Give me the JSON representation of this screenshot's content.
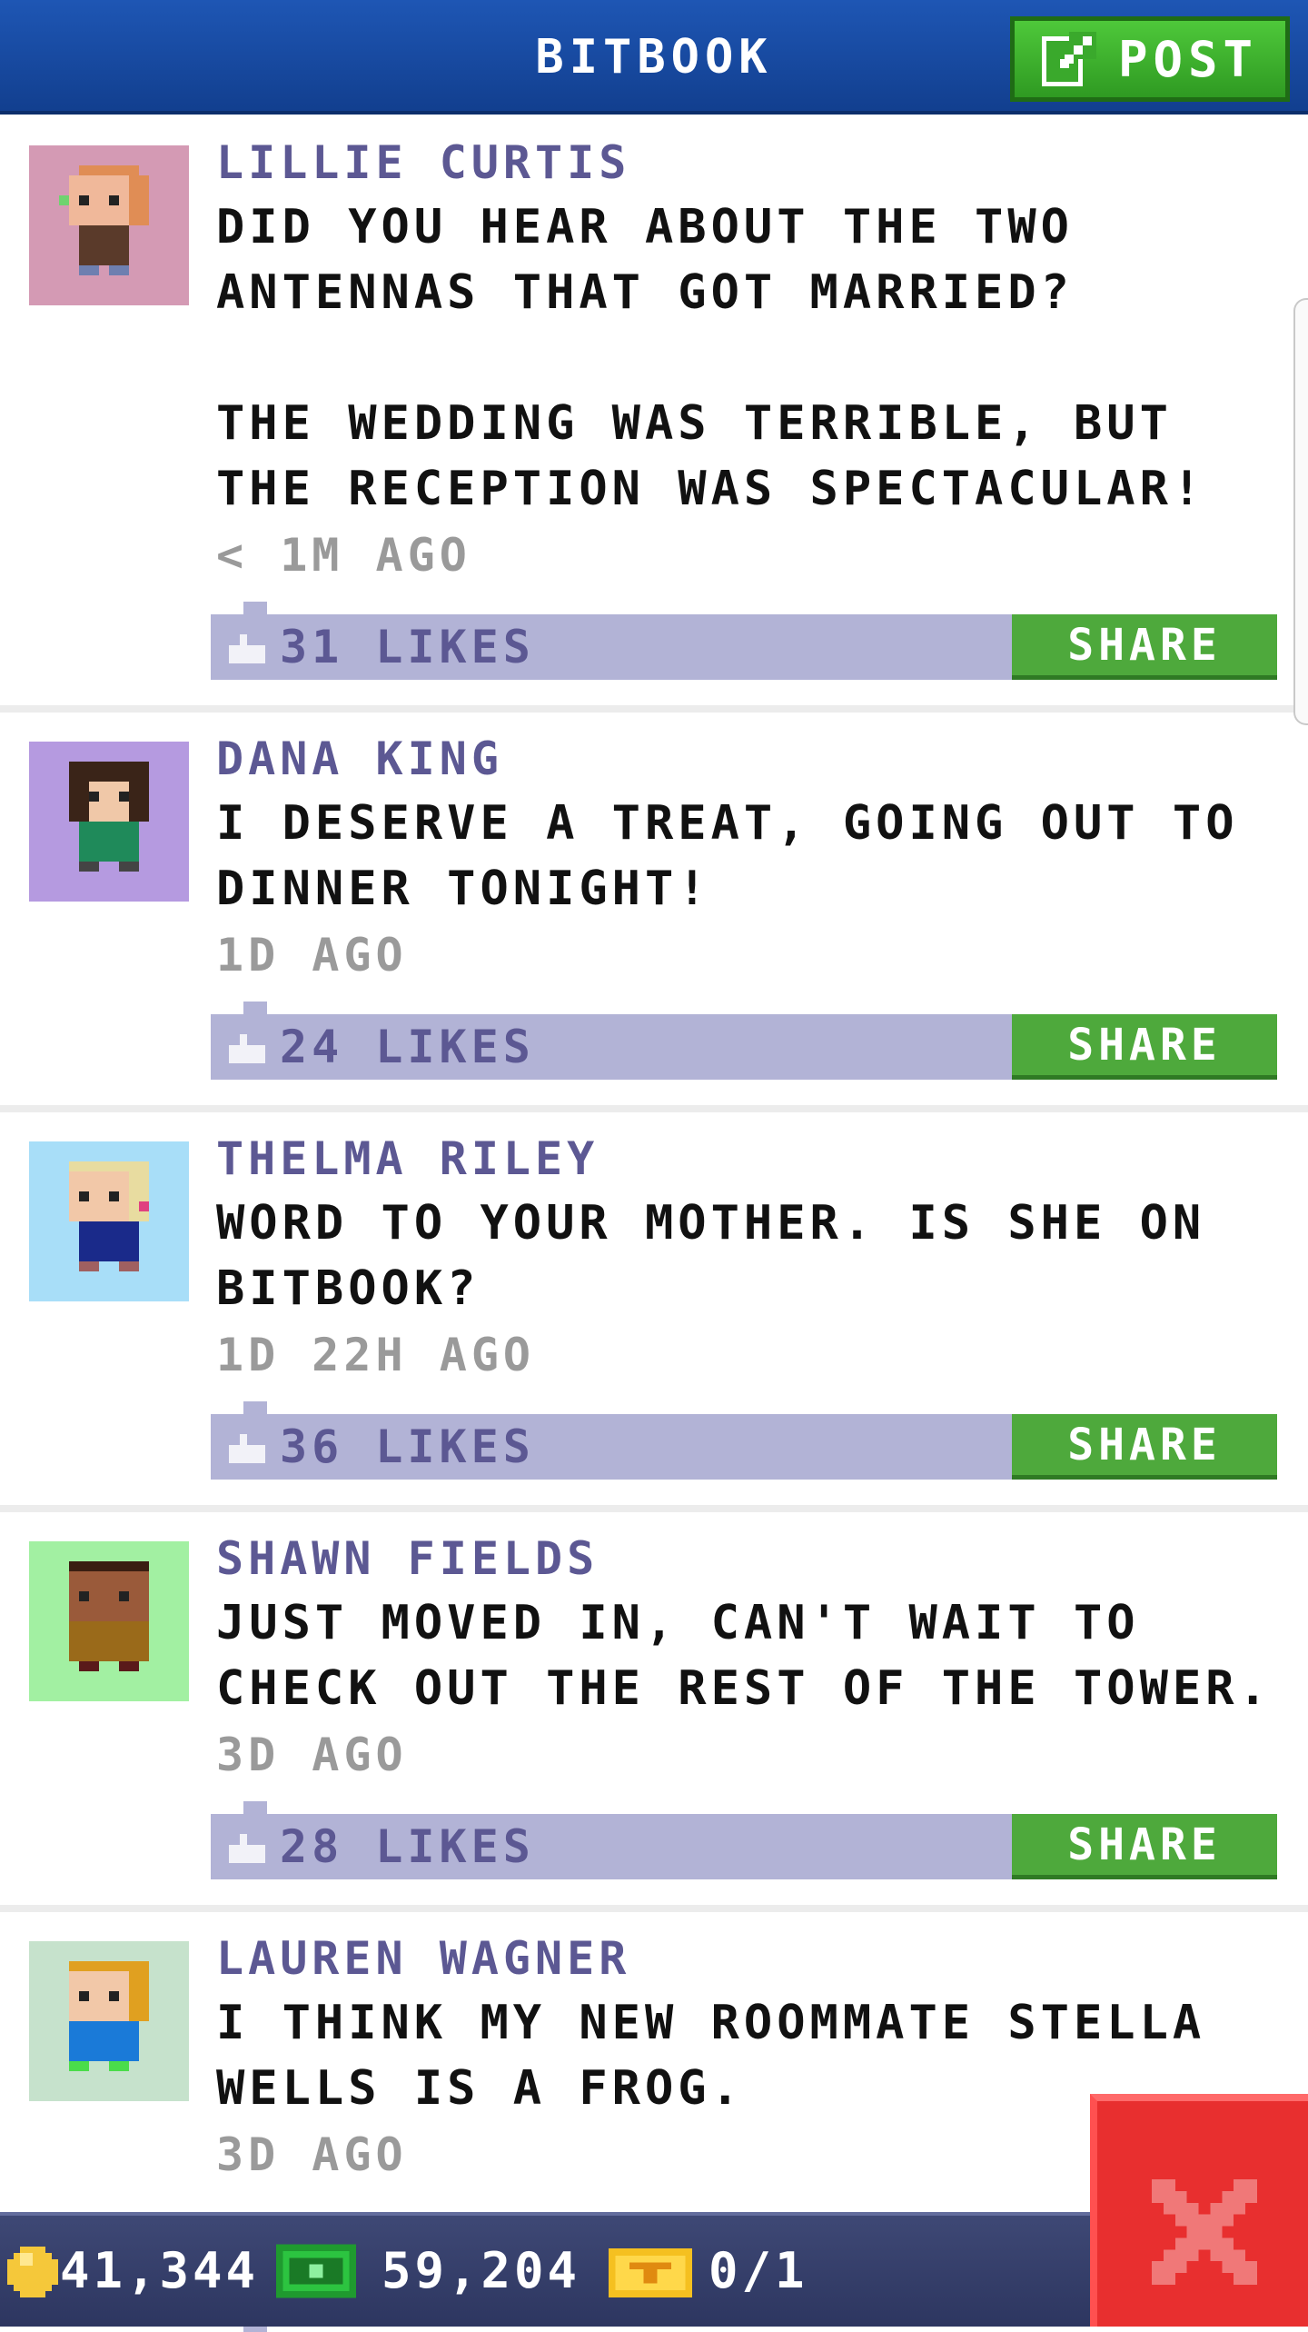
{
  "header": {
    "title": "BITBOOK",
    "post_label": "POST"
  },
  "posts": [
    {
      "author": "LILLIE CURTIS",
      "text": "DID YOU HEAR ABOUT THE TWO ANTENNAS THAT GOT MARRIED?\n\nTHE WEDDING WAS TERRIBLE, BUT THE RECEPTION WAS SPECTACULAR!",
      "time": "< 1M AGO",
      "likes": "31 LIKES",
      "share_label": "SHARE",
      "avatar_bg": "#d49ab4"
    },
    {
      "author": "DANA KING",
      "text": "I DESERVE A TREAT, GOING OUT TO DINNER TONIGHT!",
      "time": "1D AGO",
      "likes": "24 LIKES",
      "share_label": "SHARE",
      "avatar_bg": "#b59ae0"
    },
    {
      "author": "THELMA RILEY",
      "text": "WORD TO YOUR MOTHER. IS SHE ON BITBOOK?",
      "time": "1D 22H AGO",
      "likes": "36 LIKES",
      "share_label": "SHARE",
      "avatar_bg": "#a8def8"
    },
    {
      "author": "SHAWN FIELDS",
      "text": "JUST MOVED IN, CAN'T WAIT TO CHECK OUT THE REST OF THE TOWER.",
      "time": "3D AGO",
      "likes": "28 LIKES",
      "share_label": "SHARE",
      "avatar_bg": "#a2f0a2"
    },
    {
      "author": "LAUREN WAGNER",
      "text": "I THINK MY NEW ROOMMATE STELLA WELLS IS A FROG.",
      "time": "3D AGO",
      "likes": "",
      "share_label": "",
      "avatar_bg": "#c6e2cc"
    }
  ],
  "status_bar": {
    "coins": "41,344",
    "bux": "59,204",
    "tickets": "0/1"
  },
  "colors": {
    "header": "#1a4ea8",
    "like_bar": "#b2b3d6",
    "share_green": "#4ea93c",
    "author_purple": "#5c5893",
    "close_red": "#e82f2f"
  },
  "icons": {
    "post": "edit-icon",
    "like": "thumbs-up-icon",
    "coin": "coin-icon",
    "bux": "bux-icon",
    "ticket": "ticket-icon",
    "close": "close-icon"
  }
}
